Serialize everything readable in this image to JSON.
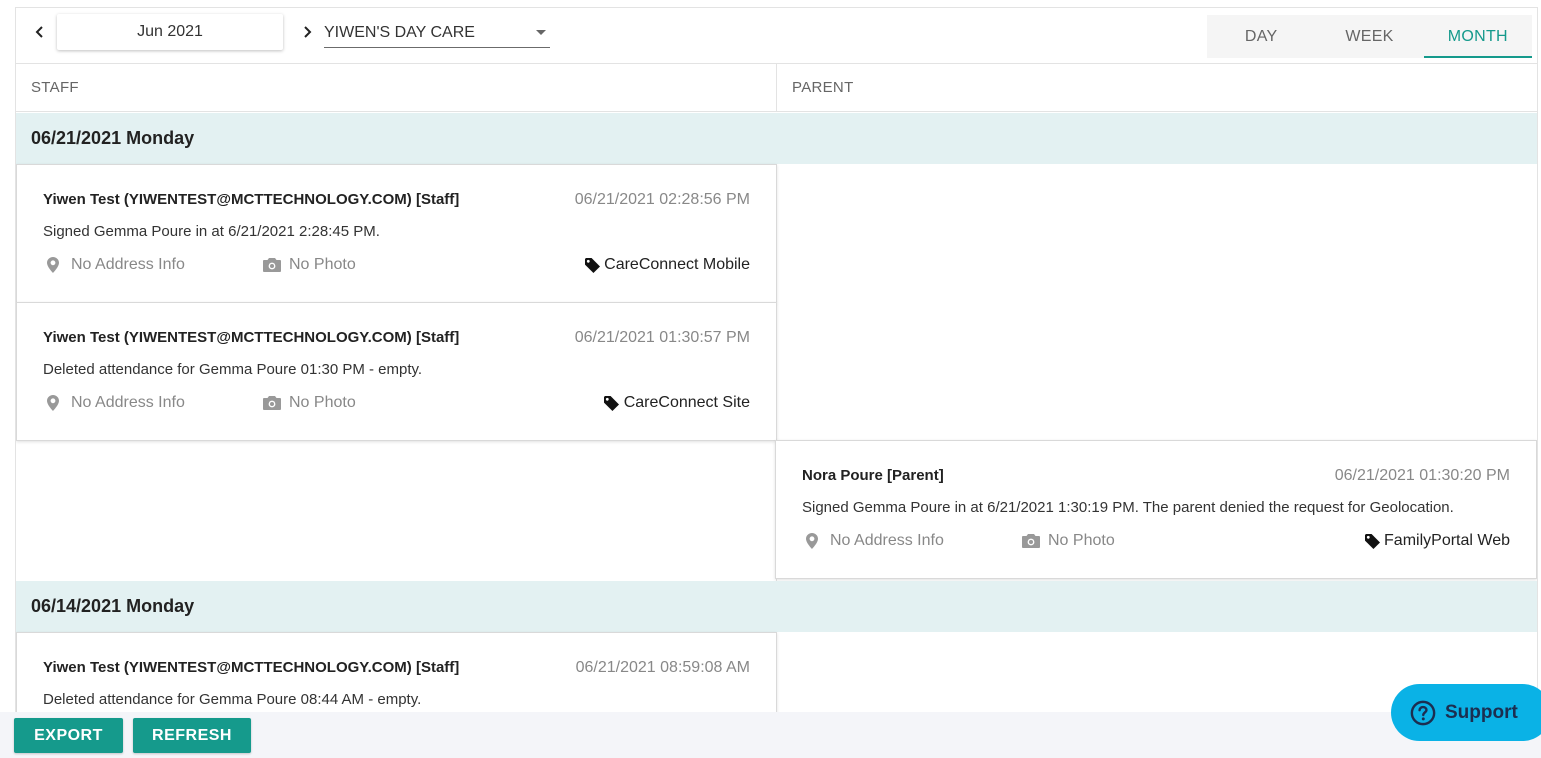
{
  "toolbar": {
    "month_label": "Jun 2021",
    "center_value": "YIWEN'S DAY CARE",
    "tabs": [
      {
        "label": "DAY",
        "active": false
      },
      {
        "label": "WEEK",
        "active": false
      },
      {
        "label": "MONTH",
        "active": true
      }
    ]
  },
  "columns": {
    "staff": "STAFF",
    "parent": "PARENT"
  },
  "days": [
    {
      "header": "06/21/2021 Monday",
      "entries": [
        {
          "column": "staff",
          "who": "Yiwen Test (YIWENTEST@MCTTECHNOLOGY.COM) [Staff]",
          "time": "06/21/2021 02:28:56 PM",
          "message": "Signed Gemma Poure in at 6/21/2021 2:28:45 PM.",
          "address": "No Address Info",
          "photo": "No Photo",
          "source": "CareConnect Mobile",
          "address_icon": "map-marker-icon",
          "photo_icon": "camera-icon",
          "source_icon": "tag-icon"
        },
        {
          "column": "staff",
          "who": "Yiwen Test (YIWENTEST@MCTTECHNOLOGY.COM) [Staff]",
          "time": "06/21/2021 01:30:57 PM",
          "message": "Deleted attendance for Gemma Poure 01:30 PM - empty.",
          "address": "No Address Info",
          "photo": "No Photo",
          "source": "CareConnect Site",
          "address_icon": "map-marker-icon",
          "photo_icon": "camera-icon",
          "source_icon": "tag-icon"
        },
        {
          "column": "parent",
          "who": "Nora Poure [Parent]",
          "time": "06/21/2021 01:30:20 PM",
          "message": "Signed Gemma Poure in at 6/21/2021 1:30:19 PM. The parent denied the request for Geolocation.",
          "address": "No Address Info",
          "photo": "No Photo",
          "source": "FamilyPortal Web",
          "address_icon": "map-marker-icon",
          "photo_icon": "camera-icon",
          "source_icon": "tag-icon"
        }
      ]
    },
    {
      "header": "06/14/2021 Monday",
      "entries": [
        {
          "column": "staff",
          "who": "Yiwen Test (YIWENTEST@MCTTECHNOLOGY.COM) [Staff]",
          "time": "06/21/2021 08:59:08 AM",
          "message": "Deleted attendance for Gemma Poure 08:44 AM - empty."
        }
      ]
    }
  ],
  "actions": {
    "export_label": "EXPORT",
    "refresh_label": "REFRESH"
  },
  "support": {
    "label": "Support",
    "icon": "help-circle-icon"
  },
  "colors": {
    "accent": "#159a8c",
    "day_header_bg": "#e3f1f2",
    "support_bg": "#0ab2e6"
  }
}
